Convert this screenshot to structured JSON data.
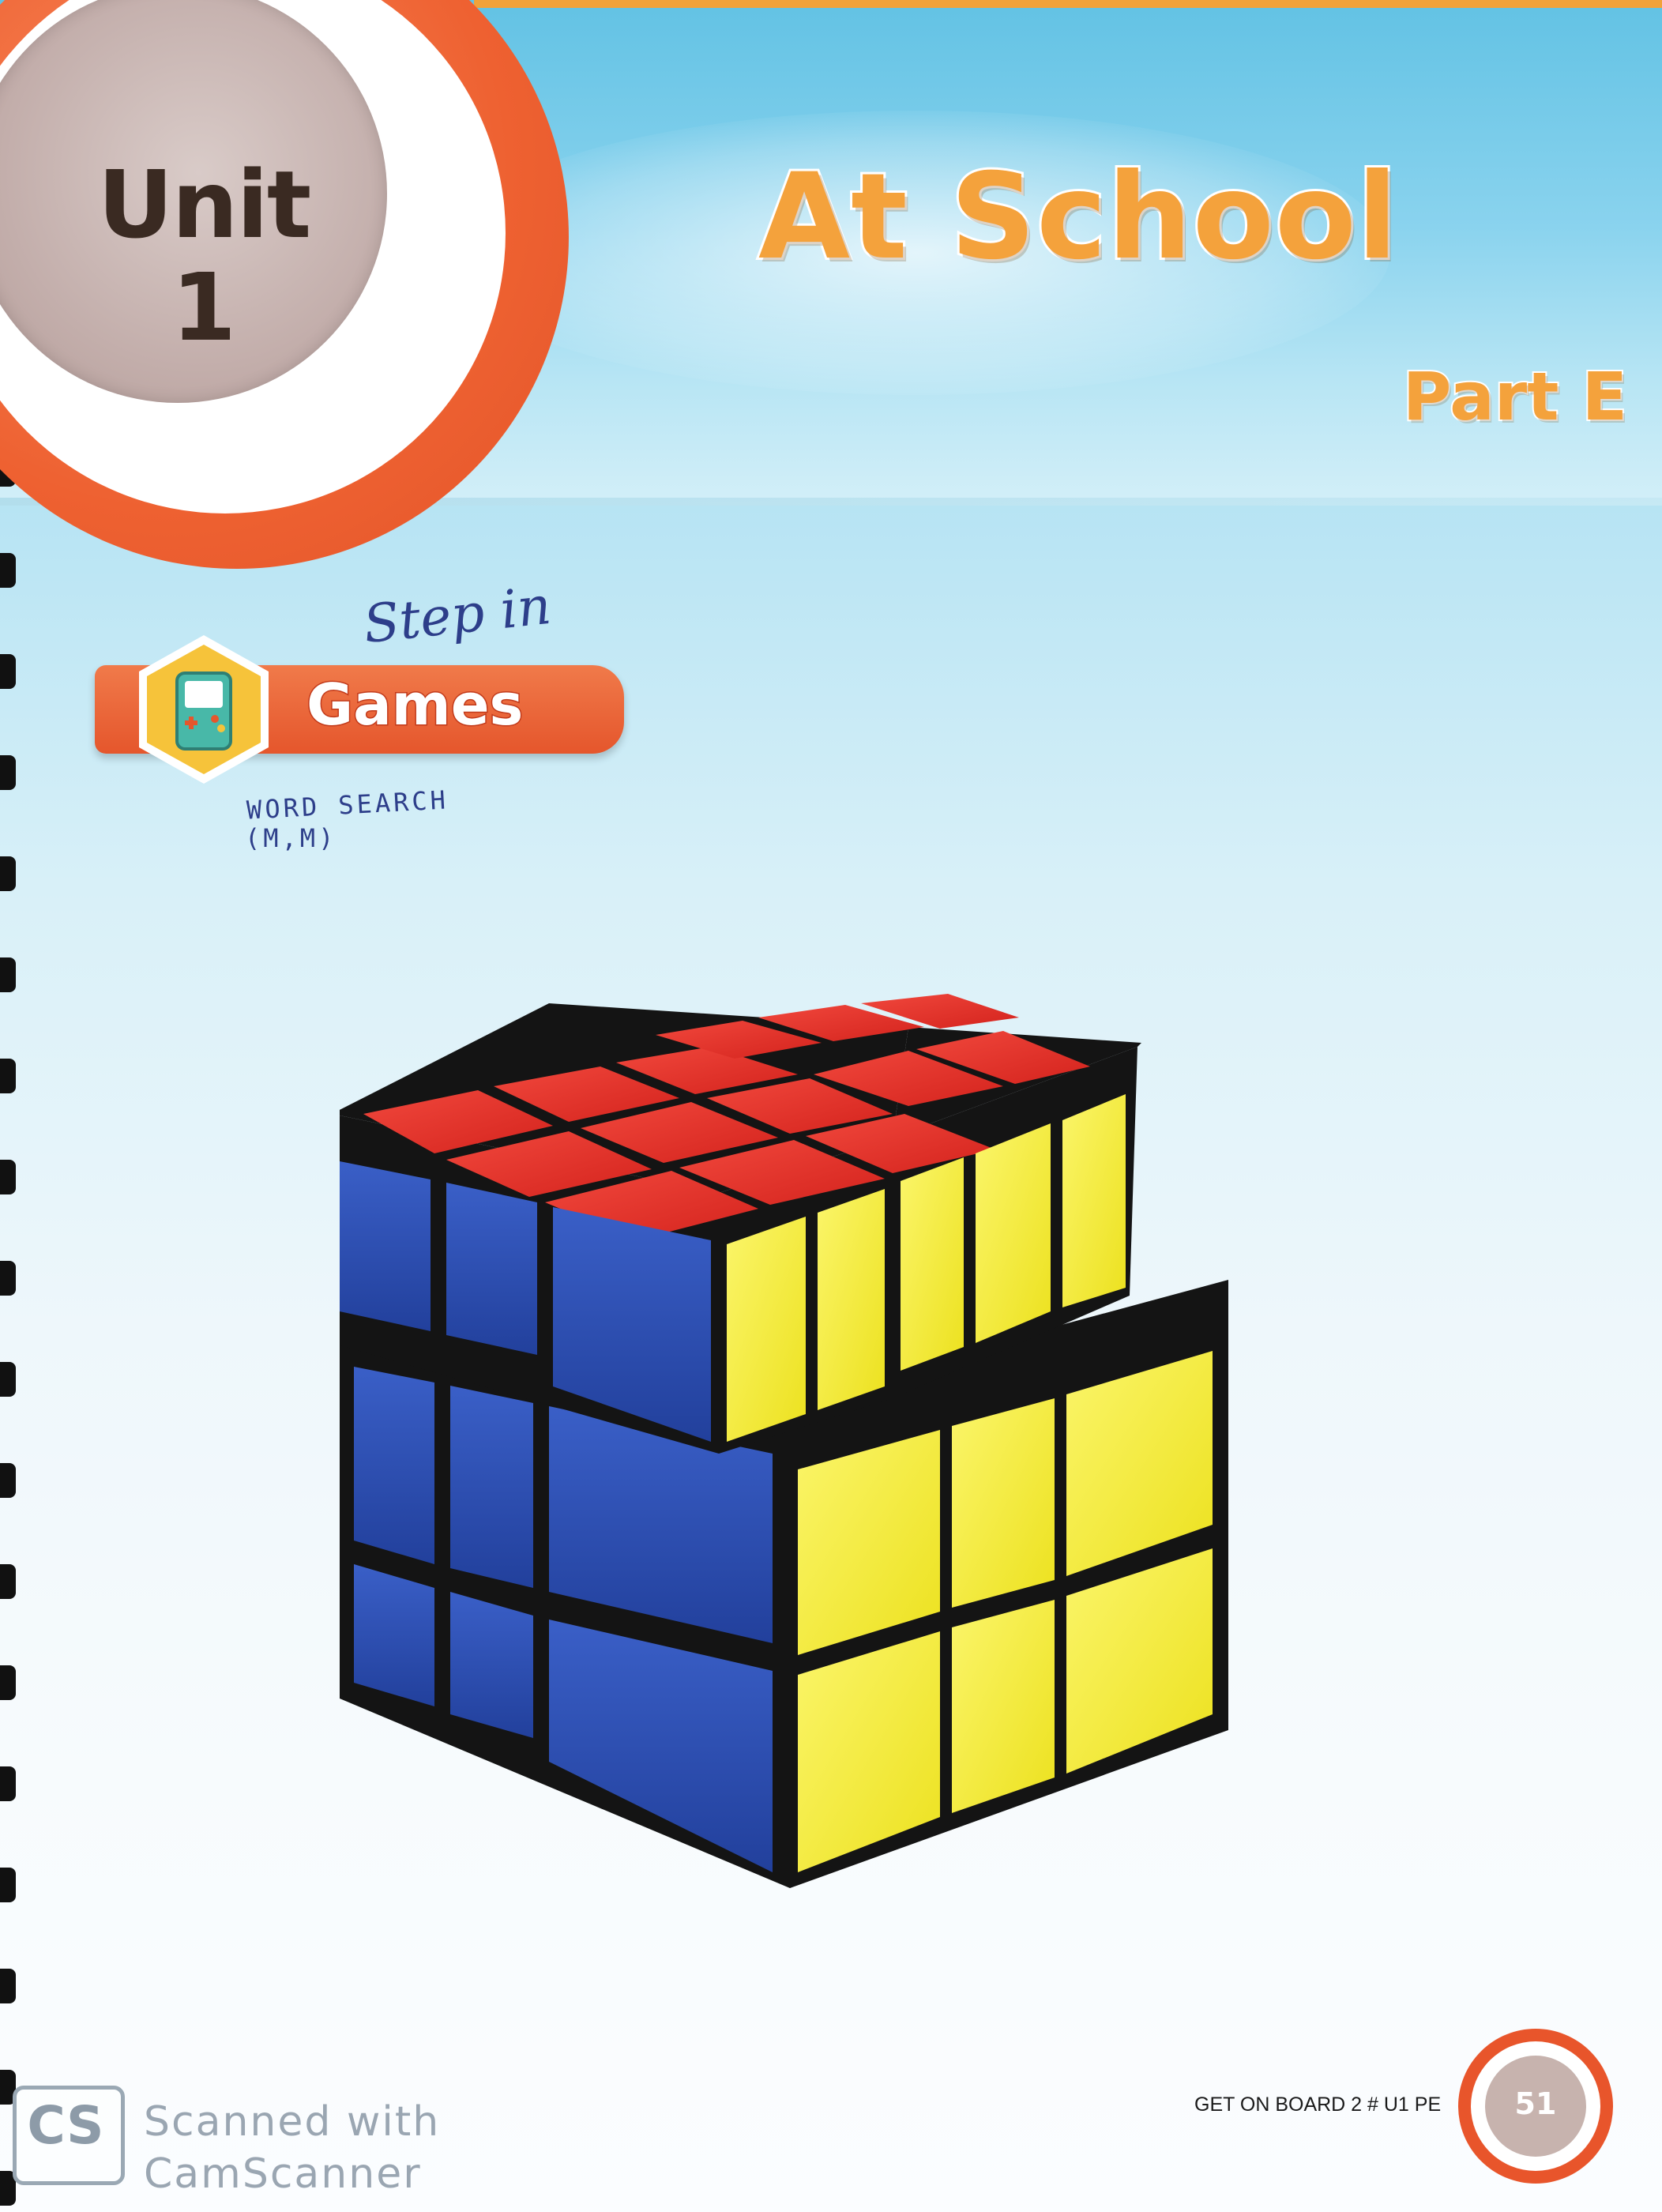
{
  "header": {
    "unit_label": "Unit",
    "unit_number": "1",
    "title": "At School",
    "part": "Part E"
  },
  "section": {
    "label": "Games",
    "icon": "game-console-icon"
  },
  "handwriting": {
    "step": "Step in",
    "word_search": "WORD SEARCH",
    "initials": "(M,M)"
  },
  "illustration": {
    "subject": "rubiks-cube-image",
    "colors": {
      "top": "#e8322a",
      "left": "#2d4fb3",
      "right": "#f2ea2c",
      "frame": "#141414"
    }
  },
  "footer": {
    "book_code": "GET ON BOARD 2 # U1 PE",
    "page_number": "51"
  },
  "watermark": {
    "logo": "CS",
    "line1": "Scanned with",
    "line2": "CamScanner"
  },
  "colors": {
    "accent_orange": "#ee6131",
    "title_orange": "#f4a23c",
    "sky_blue": "#62c2e4"
  }
}
